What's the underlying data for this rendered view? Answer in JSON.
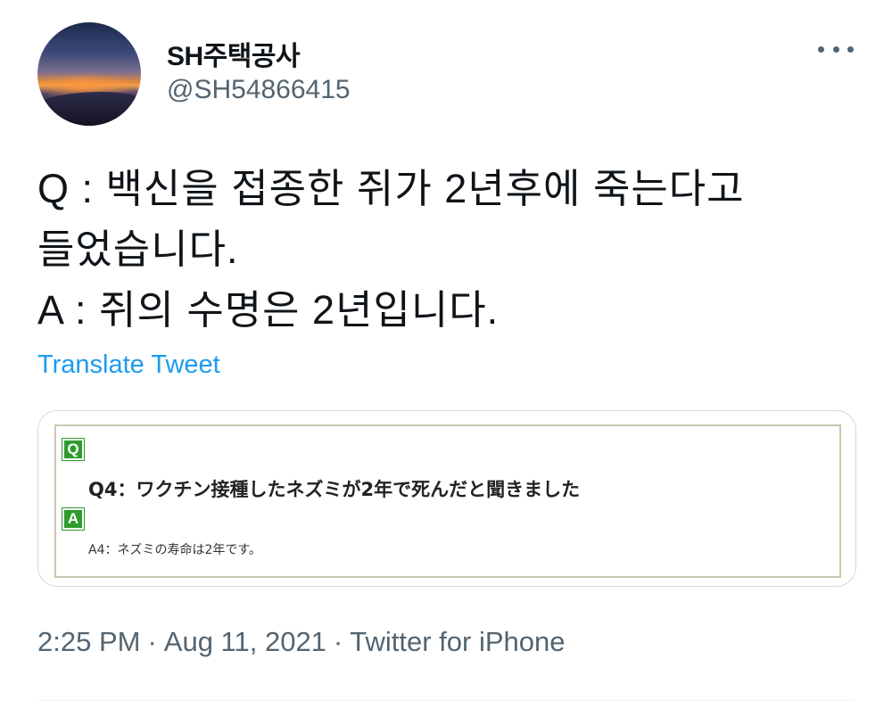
{
  "author": {
    "display_name": "SH주택공사",
    "handle": "@SH54866415"
  },
  "tweet": {
    "lines": [
      "Q : 백신을 접종한 쥐가 2년후에 죽는다고",
      "들었습니다.",
      "A : 쥐의 수명은 2년입니다."
    ],
    "translate_label": "Translate Tweet"
  },
  "card": {
    "q_badge": "Q",
    "question": "Q4：ワクチン接種したネズミが2年で死んだと聞きました",
    "a_badge": "A",
    "answer": "A4：ネズミの寿命は2年です。"
  },
  "meta": {
    "time": "2:25 PM",
    "date": "Aug 11, 2021",
    "source": "Twitter for iPhone",
    "separator": "·"
  },
  "colors": {
    "link": "#1d9bf0",
    "secondary_text": "#536471",
    "badge_green": "#2e9b2e"
  },
  "icons": {
    "more": "more-horizontal-icon"
  }
}
